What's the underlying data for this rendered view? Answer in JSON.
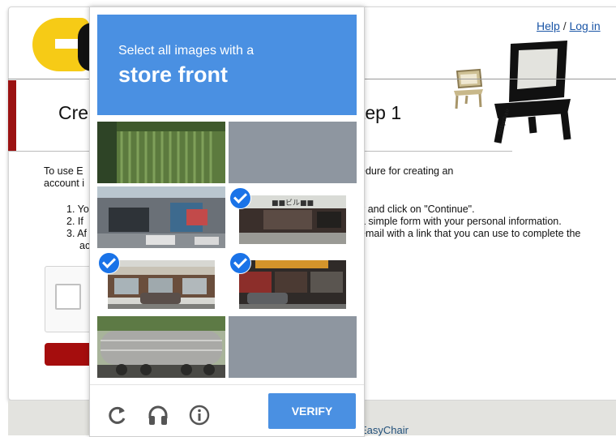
{
  "header": {
    "help_link": "Help",
    "separator": "/",
    "login_link": "Log in"
  },
  "page": {
    "title_visible": "Cre",
    "title_tail": "tep 1",
    "intro_line1": "To use E",
    "intro_line2": "account i",
    "intro_tail": "edure for creating an",
    "steps": [
      {
        "prefix": "1. Yo",
        "tail": "y and click on \"Continue\"."
      },
      {
        "prefix": "2. If",
        "tail": "a simple form with your personal information."
      },
      {
        "prefix": "3. Af",
        "tail": "email with a link that you can use to complete the"
      },
      {
        "prefix": "ac",
        "tail": ""
      }
    ]
  },
  "footer": {
    "text": "EasyChair"
  },
  "challenge": {
    "instruction": "Select all images with a",
    "target": "store front",
    "verify_label": "VERIFY",
    "accent_color": "#4a90e2",
    "check_color": "#1a73e8",
    "tiles": [
      {
        "name": "tile-1-1",
        "kind": "photo",
        "selected": false
      },
      {
        "name": "tile-1-2",
        "kind": "blank",
        "selected": false
      },
      {
        "name": "tile-2-1",
        "kind": "photo",
        "selected": false
      },
      {
        "name": "tile-2-2",
        "kind": "photo",
        "selected": true
      },
      {
        "name": "tile-3-1",
        "kind": "photo",
        "selected": true
      },
      {
        "name": "tile-3-2",
        "kind": "photo",
        "selected": true
      },
      {
        "name": "tile-4-1",
        "kind": "photo",
        "selected": false
      },
      {
        "name": "tile-4-2",
        "kind": "blank",
        "selected": false
      }
    ],
    "icons": [
      "reload-icon",
      "audio-icon",
      "info-icon"
    ]
  }
}
